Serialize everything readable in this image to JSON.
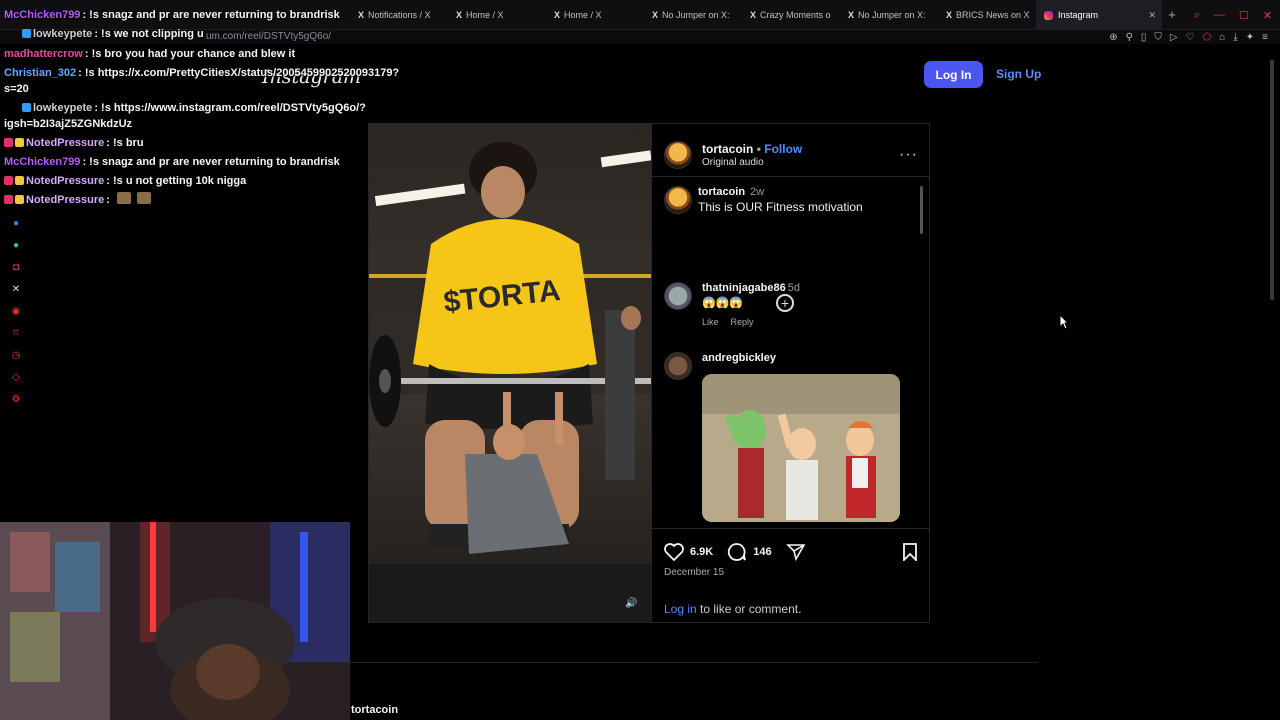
{
  "browser": {
    "tabs": [
      {
        "label": "Notifications / X",
        "prefix": "X"
      },
      {
        "label": "Home / X",
        "prefix": "X"
      },
      {
        "label": "Home / X",
        "prefix": "X"
      },
      {
        "label": "No Jumper on X:",
        "prefix": "X"
      },
      {
        "label": "Crazy Moments o",
        "prefix": "X"
      },
      {
        "label": "No Jumper on X:",
        "prefix": "X"
      },
      {
        "label": "BRICS News on X",
        "prefix": "X"
      }
    ],
    "active_tab": "Instagram",
    "new_tab": "+",
    "url": "um.com/reel/DSTVty5gQ6o/"
  },
  "chat": [
    {
      "name": "McChicken799",
      "name_color": "#b35cff",
      "text": ": !s snagz and pr are never returning to brandrisk"
    },
    {
      "name": "lowkeypete",
      "name_color": "#cfcfcf",
      "text": ": !s we not clipping u"
    },
    {
      "name": "madhattercrow",
      "name_color": "#e64aa6",
      "text": ": !s bro you had your chance and blew it"
    },
    {
      "name": "Christian_302",
      "name_color": "#62a8ff",
      "text": ": !s https://x.com/PrettyCitiesX/status/2005459902520093179?"
    },
    {
      "name": "",
      "name_color": "#fff",
      "text": "s=20"
    },
    {
      "name": "lowkeypete",
      "name_color": "#cfcfcf",
      "text": ": !s https://www.instagram.com/reel/DSTVty5gQ6o/?"
    },
    {
      "name": "",
      "name_color": "#fff",
      "text": "igsh=b2I3ajZ5ZGNkdzUz"
    },
    {
      "name": "NotedPressure",
      "name_color": "#d6a8ff",
      "text": ": !s bru"
    },
    {
      "name": "McChicken799",
      "name_color": "#b35cff",
      "text": ": !s snagz and pr are never returning to brandrisk"
    },
    {
      "name": "NotedPressure",
      "name_color": "#d6a8ff",
      "text": ": !s u not getting 10k nigga"
    },
    {
      "name": "NotedPressure",
      "name_color": "#d6a8ff",
      "text": ":"
    }
  ],
  "instagram": {
    "logo": "Instagram",
    "login_label": "Log In",
    "signup_label": "Sign Up",
    "post": {
      "username": "tortacoin",
      "separator": "•",
      "follow_label": "Follow",
      "audio": "Original audio",
      "more": "···",
      "shirt_text": "$TORTA",
      "caption": {
        "username": "tortacoin",
        "time": "2w",
        "text": "This is OUR Fitness motivation"
      },
      "comments": [
        {
          "username": "thatninjagabe86",
          "time": "5d",
          "text": "😱😱😱",
          "like": "Like",
          "reply": "Reply"
        },
        {
          "username": "andregbickley",
          "time": "",
          "text": ""
        }
      ],
      "likes": "6.9K",
      "comments_count": "146",
      "date": "December 15",
      "login_link": "Log in",
      "login_suffix": " to like or comment."
    },
    "footer_username": "tortacoin"
  },
  "colors": {
    "accent": "#4b55f0",
    "link": "#4f8cff",
    "bg": "#000000"
  }
}
